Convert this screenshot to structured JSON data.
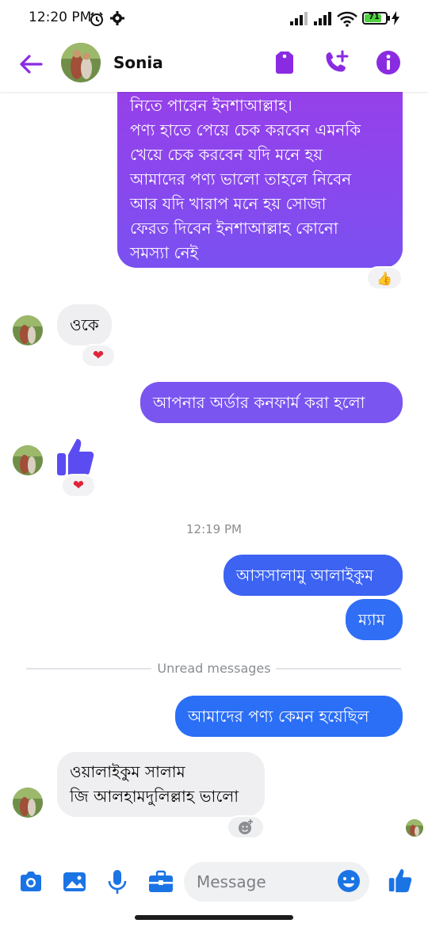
{
  "status_bar": {
    "time": "12:20 PM",
    "battery": "71"
  },
  "header": {
    "contact_name": "Sonia"
  },
  "colors": {
    "accent": "#8a2be2",
    "out_top": "#9a3ee8",
    "out_mid": "#7b4cf0",
    "out_bottom": "#2f6ef5",
    "heart": "#e0243c"
  },
  "messages": [
    {
      "from": "me",
      "text": "নিতে পারেন ইনশাআল্লাহ।\nপণ্য হাতে পেয়ে চেক করবেন এমনকি\nখেয়ে চেক করবেন যদি মনে হয়\nআমাদের পণ্য ভালো তাহলে নিবেন\nআর যদি খারাপ মনে হয় সোজা\nফেরত দিবেন ইনশাআল্লাহ কোনো\nসমস্যা নেই",
      "reaction": "👍"
    },
    {
      "from": "them",
      "text": "ওকে",
      "reaction": "❤"
    },
    {
      "from": "me",
      "text": "আপনার অর্ডার কনফার্ম করা হলো"
    },
    {
      "from": "them",
      "type": "like-sticker",
      "reaction": "❤"
    },
    {
      "from": "me",
      "text": "আসসালামু আলাইকুম"
    },
    {
      "from": "me",
      "text": "ম্যাম"
    },
    {
      "from": "me",
      "text": "আমাদের পণ্য কেমন হয়েছিল"
    },
    {
      "from": "them",
      "text": "ওয়ালাইকুম সালাম\nজি আলহামদুলিল্লাহ ভালো"
    }
  ],
  "timestamp": "12:19 PM",
  "unread_label": "Unread messages",
  "composer": {
    "placeholder": "Message"
  }
}
